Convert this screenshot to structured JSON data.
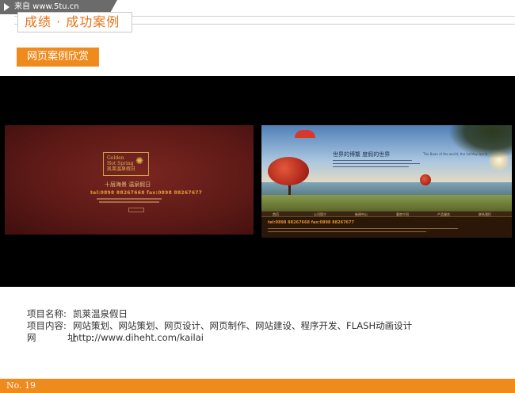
{
  "watermark": {
    "text": "来自 www.5tu.cn"
  },
  "header": {
    "title": "成绩 · 成功案例"
  },
  "section": {
    "badge": "网页案例欣赏"
  },
  "screenshots": {
    "left": {
      "logo_line1": "Golden",
      "logo_line2": "Hot Spring",
      "logo_cn": "凯莱温泉假日",
      "slogan": "十层海景 温泉假日",
      "tel": "tel:0898 88267668  fax:0898 88267677"
    },
    "right": {
      "headline": "世界的博鳌 度假的世界",
      "headline_en": "The Boao of the world, the holiday world",
      "nav": [
        "首页",
        "公司简介",
        "新闻中心",
        "客房介绍",
        "产品服务",
        "联系我们"
      ],
      "tel": "tel:0898 88267668  fax:0898 88267677"
    }
  },
  "info": {
    "name_label": "项目名称:",
    "name_value": "凯莱温泉假日",
    "content_label": "项目内容:",
    "content_value": "网站策划、网站策划、网页设计、网页制作、网站建设、程序开发、FLASH动画设计",
    "url_label": "网 址:",
    "url_value": "http://www.diheht.com/kailai"
  },
  "footer": {
    "page": "No. 19"
  },
  "colors": {
    "accent": "#ef8a1d",
    "title_text": "#e8731a",
    "stage": "#000000"
  }
}
